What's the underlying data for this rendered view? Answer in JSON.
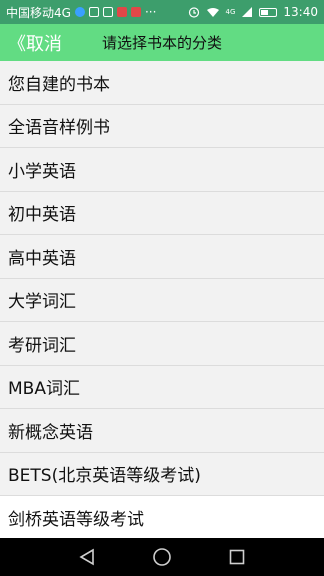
{
  "status_bar": {
    "carrier": "中国移动4G",
    "more": "···",
    "network": "4G",
    "time": "13:40"
  },
  "header": {
    "back_label": "取消",
    "title": "请选择书本的分类"
  },
  "categories": [
    {
      "label": "您自建的书本"
    },
    {
      "label": "全语音样例书"
    },
    {
      "label": "小学英语"
    },
    {
      "label": "初中英语"
    },
    {
      "label": "高中英语"
    },
    {
      "label": "大学词汇"
    },
    {
      "label": "考研词汇"
    },
    {
      "label": "MBA词汇"
    },
    {
      "label": "新概念英语"
    },
    {
      "label": "BETS(北京英语等级考试)"
    },
    {
      "label": "剑桥英语等级考试"
    }
  ],
  "colors": {
    "status_bar": "#3d9e6c",
    "header": "#62dc83",
    "list_background": "#f2f2f2",
    "divider": "#dcdcdc",
    "navbar": "#000000"
  }
}
